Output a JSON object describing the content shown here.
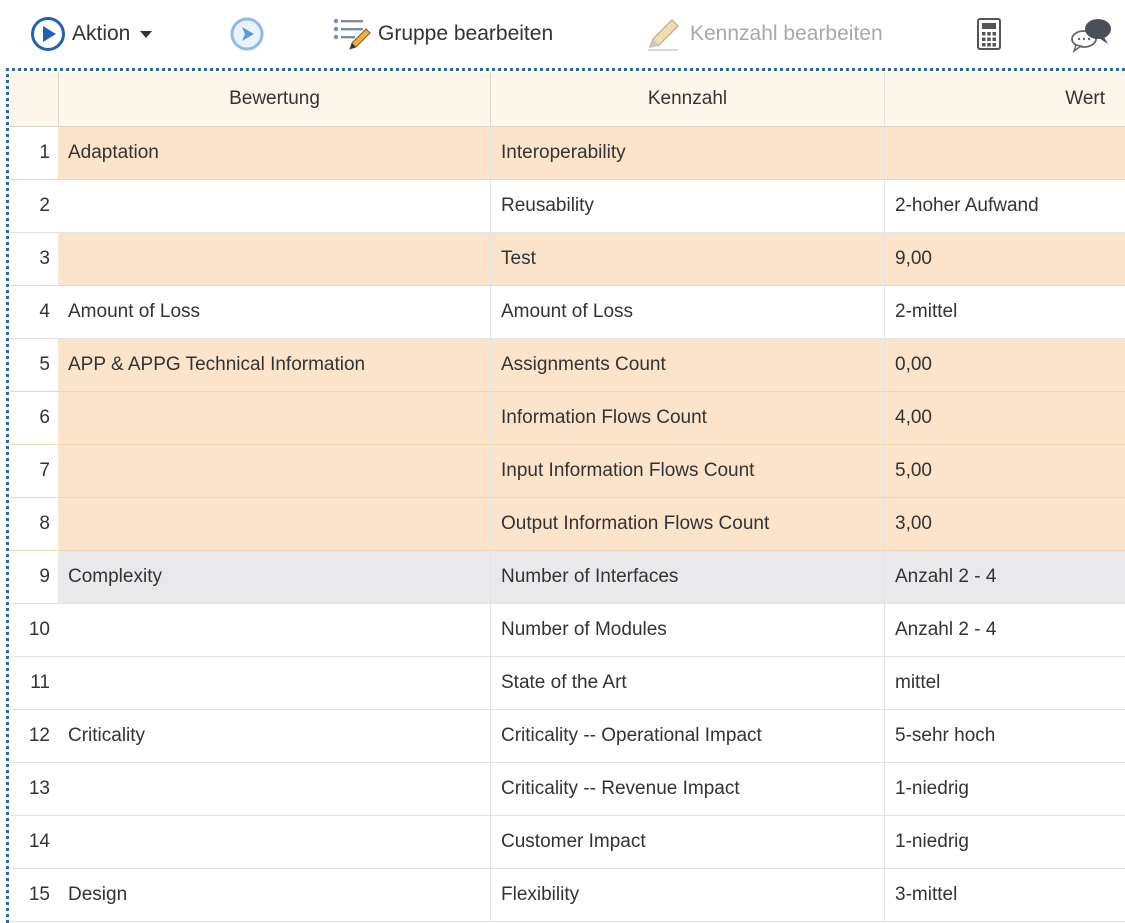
{
  "toolbar": {
    "aktion_label": "Aktion",
    "gruppe_label": "Gruppe bearbeiten",
    "kennzahl_label": "Kennzahl bearbeiten",
    "icons": [
      "play-circle-icon",
      "forward-icon",
      "edit-group-icon",
      "pencil-icon",
      "calculator-icon",
      "comments-icon"
    ]
  },
  "columns": {
    "bewertung": "Bewertung",
    "kennzahl": "Kennzahl",
    "wert": "Wert"
  },
  "rows": [
    {
      "num": "1",
      "bewertung": "Adaptation",
      "kennzahl": "Interoperability",
      "wert": ""
    },
    {
      "num": "2",
      "bewertung": "",
      "kennzahl": "Reusability",
      "wert": "2-hoher Aufwand"
    },
    {
      "num": "3",
      "bewertung": "",
      "kennzahl": "Test",
      "wert": "9,00"
    },
    {
      "num": "4",
      "bewertung": "Amount of Loss",
      "kennzahl": "Amount of Loss",
      "wert": "2-mittel"
    },
    {
      "num": "5",
      "bewertung": "APP & APPG Technical Information",
      "kennzahl": "Assignments Count",
      "wert": "0,00"
    },
    {
      "num": "6",
      "bewertung": "",
      "kennzahl": "Information Flows Count",
      "wert": "4,00"
    },
    {
      "num": "7",
      "bewertung": "",
      "kennzahl": "Input Information Flows Count",
      "wert": "5,00"
    },
    {
      "num": "8",
      "bewertung": "",
      "kennzahl": "Output Information Flows Count",
      "wert": "3,00"
    },
    {
      "num": "9",
      "bewertung": "Complexity",
      "kennzahl": "Number of Interfaces",
      "wert": "Anzahl 2 - 4"
    },
    {
      "num": "10",
      "bewertung": "",
      "kennzahl": "Number of Modules",
      "wert": "Anzahl 2 - 4"
    },
    {
      "num": "11",
      "bewertung": "",
      "kennzahl": "State of the Art",
      "wert": "mittel"
    },
    {
      "num": "12",
      "bewertung": "Criticality",
      "kennzahl": "Criticality -- Operational Impact",
      "wert": "5-sehr hoch"
    },
    {
      "num": "13",
      "bewertung": "",
      "kennzahl": "Criticality -- Revenue Impact",
      "wert": "1-niedrig"
    },
    {
      "num": "14",
      "bewertung": "",
      "kennzahl": "Customer Impact",
      "wert": "1-niedrig"
    },
    {
      "num": "15",
      "bewertung": "Design",
      "kennzahl": "Flexibility",
      "wert": "3-mittel"
    }
  ],
  "colors": {
    "highlight_orange": "#fce4cc",
    "highlight_gray": "#e9e9ec",
    "accent_blue": "#1f63b3"
  }
}
